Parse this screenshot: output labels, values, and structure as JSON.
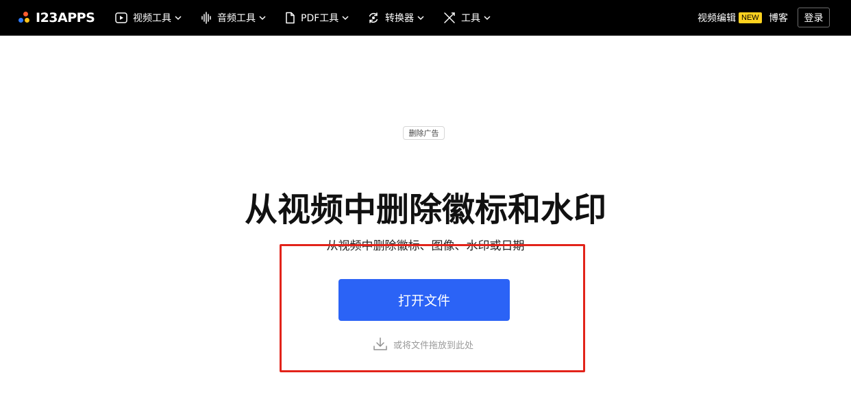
{
  "colors": {
    "header_bg": "#000000",
    "accent_blue": "#2b63f6",
    "badge_yellow": "#ffd21f",
    "highlight_red": "#e2231a",
    "logo_dot_orange": "#ff5b2e",
    "logo_dot_blue": "#2f7bff",
    "logo_dot_yellow": "#ffc21a"
  },
  "header": {
    "logo_text": "I23APPS",
    "nav": [
      {
        "label": "视频工具",
        "icon": "play-circle-icon"
      },
      {
        "label": "音频工具",
        "icon": "sound-wave-icon"
      },
      {
        "label": "PDF工具",
        "icon": "document-icon"
      },
      {
        "label": "转换器",
        "icon": "convert-icon"
      },
      {
        "label": "工具",
        "icon": "tools-icon"
      }
    ],
    "video_editor_label": "视频编辑",
    "new_badge": "NEW",
    "blog_label": "博客",
    "login_label": "登录"
  },
  "main": {
    "remove_ads_label": "删除广告",
    "title": "从视频中删除徽标和水印",
    "subtitle": "从视频中删除徽标、图像、水印或日期",
    "open_file_label": "打开文件",
    "drop_hint": "或将文件拖放到此处"
  }
}
